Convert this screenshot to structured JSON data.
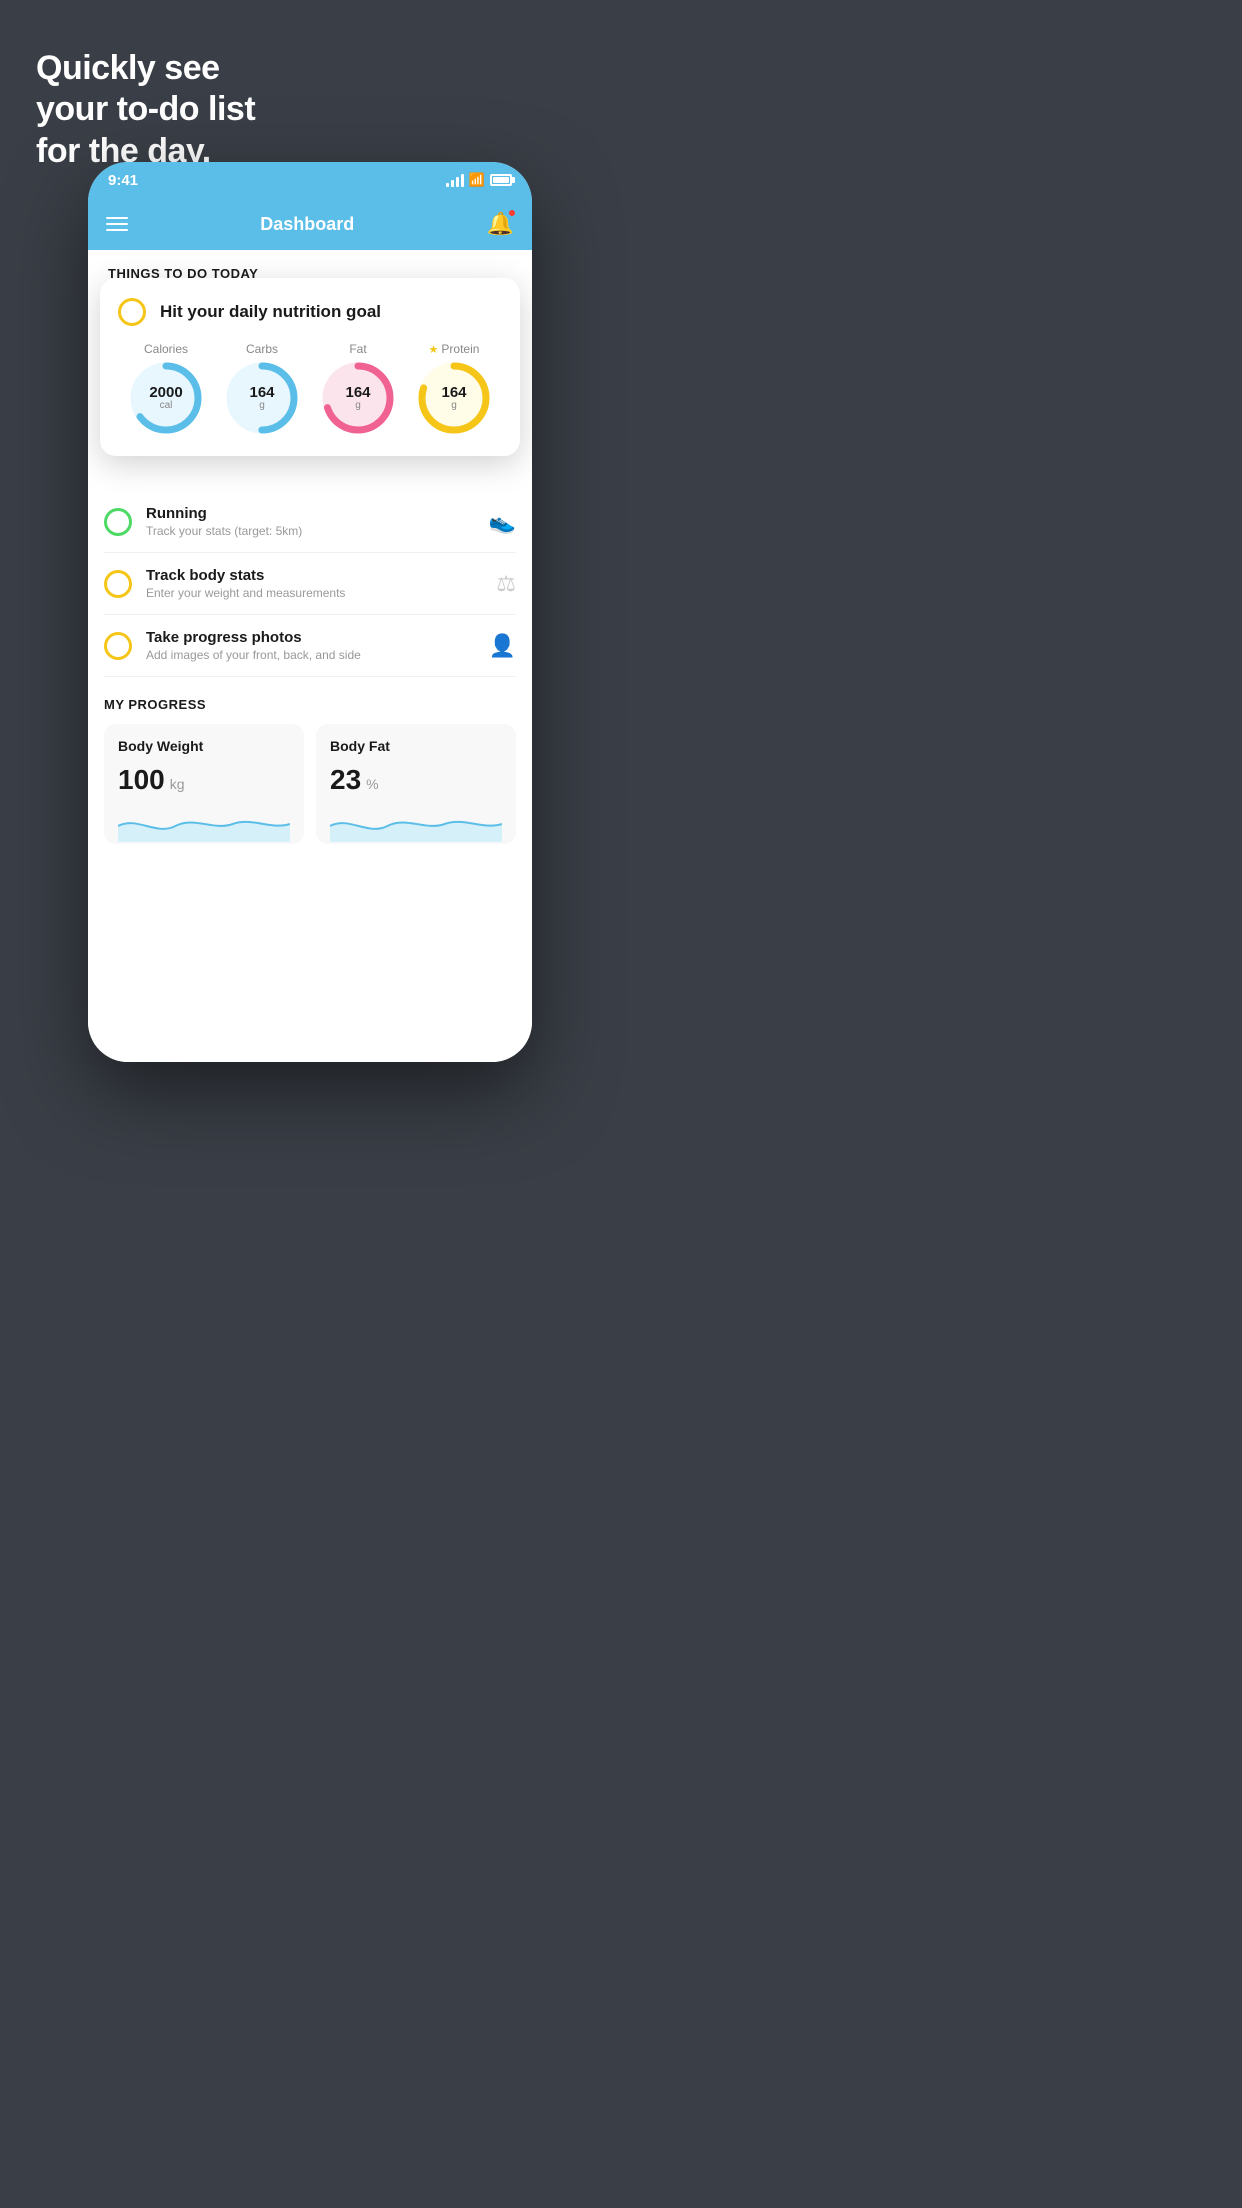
{
  "headline": {
    "line1": "Quickly see",
    "line2": "your to-do list",
    "line3": "for the day."
  },
  "statusBar": {
    "time": "9:41"
  },
  "navBar": {
    "title": "Dashboard"
  },
  "sectionLabel": "THINGS TO DO TODAY",
  "floatingCard": {
    "title": "Hit your daily nutrition goal",
    "nutrition": [
      {
        "label": "Calories",
        "value": "2000",
        "unit": "cal",
        "color": "#5bbee8",
        "bg": "#e8f6fd",
        "progress": 0.65,
        "star": false
      },
      {
        "label": "Carbs",
        "value": "164",
        "unit": "g",
        "color": "#5bbee8",
        "bg": "#e8f6fd",
        "progress": 0.5,
        "star": false
      },
      {
        "label": "Fat",
        "value": "164",
        "unit": "g",
        "color": "#f06292",
        "bg": "#fce4ec",
        "progress": 0.7,
        "star": false
      },
      {
        "label": "Protein",
        "value": "164",
        "unit": "g",
        "color": "#f5c518",
        "bg": "#fffde7",
        "progress": 0.8,
        "star": true
      }
    ]
  },
  "todoItems": [
    {
      "title": "Running",
      "subtitle": "Track your stats (target: 5km)",
      "circleColor": "#4cd964",
      "icon": "👟"
    },
    {
      "title": "Track body stats",
      "subtitle": "Enter your weight and measurements",
      "circleColor": "#f5c518",
      "icon": "⚖"
    },
    {
      "title": "Take progress photos",
      "subtitle": "Add images of your front, back, and side",
      "circleColor": "#f5c518",
      "icon": "👤"
    }
  ],
  "progressSection": {
    "title": "MY PROGRESS",
    "cards": [
      {
        "title": "Body Weight",
        "value": "100",
        "unit": "kg"
      },
      {
        "title": "Body Fat",
        "value": "23",
        "unit": "%"
      }
    ]
  }
}
